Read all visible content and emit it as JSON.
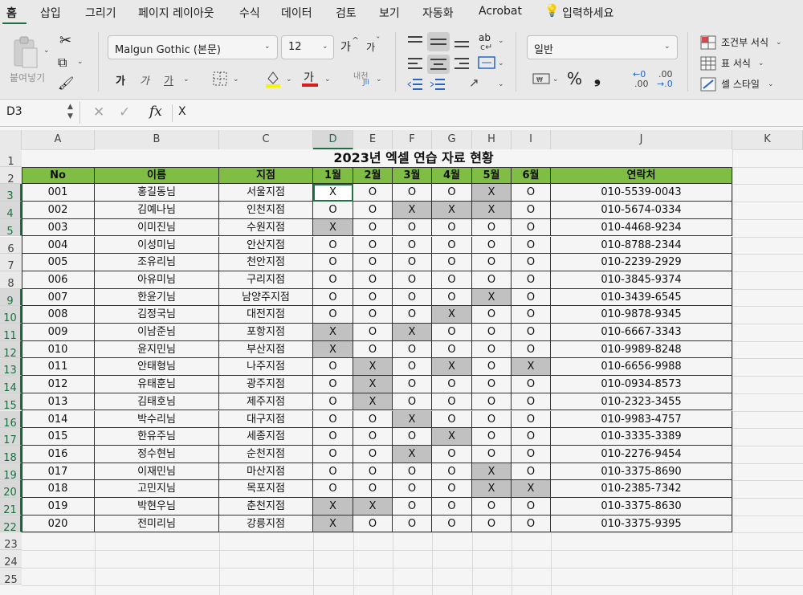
{
  "tabs": [
    "홈",
    "삽입",
    "그리기",
    "페이지 레이아웃",
    "수식",
    "데이터",
    "검토",
    "보기",
    "자동화",
    "Acrobat",
    "입력하세요"
  ],
  "ribbon": {
    "paste_label": "붙여넣기",
    "font_name": "Malgun Gothic (본문)",
    "font_size": "12",
    "grow_font": "가",
    "shrink_font": "가",
    "bold": "가",
    "italic": "가",
    "underline": "가",
    "font_color_glyph": "가",
    "phonetic": "내천",
    "number_format": "일반",
    "conditional_format": "조건부 서식",
    "format_table": "표 서식",
    "cell_styles": "셀 스타일",
    "percent": "%",
    "comma": "❟",
    "inc_decimal_a": "←0",
    "inc_decimal_b": ".00",
    "dec_decimal_a": ".00",
    "dec_decimal_b": "→.0",
    "wrap_text": "ab"
  },
  "formula_bar": {
    "name_box": "D3",
    "fx": "fx",
    "value": "X"
  },
  "sheet": {
    "columns": [
      "A",
      "B",
      "C",
      "D",
      "E",
      "F",
      "G",
      "H",
      "I",
      "J",
      "K"
    ],
    "selected_column": "D",
    "selected_rows": [
      3,
      4,
      5,
      9,
      10,
      11,
      12,
      13,
      14,
      15,
      16,
      17,
      18,
      19,
      20,
      21,
      22
    ],
    "row_numbers": [
      "1",
      "2",
      "3",
      "4",
      "5",
      "6",
      "7",
      "8",
      "9",
      "10",
      "11",
      "12",
      "13",
      "14",
      "15",
      "16",
      "17",
      "18",
      "19",
      "20",
      "21",
      "22",
      "23",
      "24",
      "25"
    ],
    "title": "2023년 엑셀 연습 자료 현황",
    "headers": [
      "No",
      "이름",
      "지점",
      "1월",
      "2월",
      "3월",
      "4월",
      "5월",
      "6월",
      "연락처"
    ],
    "rows": [
      [
        "001",
        "홍길동님",
        "서울지점",
        "X",
        "O",
        "O",
        "O",
        "X",
        "O",
        "010-5539-0043"
      ],
      [
        "002",
        "김예나님",
        "인천지점",
        "O",
        "O",
        "X",
        "X",
        "X",
        "O",
        "010-5674-0334"
      ],
      [
        "003",
        "이미진님",
        "수원지점",
        "X",
        "O",
        "O",
        "O",
        "O",
        "O",
        "010-4468-9234"
      ],
      [
        "004",
        "이성미님",
        "안산지점",
        "O",
        "O",
        "O",
        "O",
        "O",
        "O",
        "010-8788-2344"
      ],
      [
        "005",
        "조유리님",
        "천안지점",
        "O",
        "O",
        "O",
        "O",
        "O",
        "O",
        "010-2239-2929"
      ],
      [
        "006",
        "아유미님",
        "구리지점",
        "O",
        "O",
        "O",
        "O",
        "O",
        "O",
        "010-3845-9374"
      ],
      [
        "007",
        "한윤기님",
        "남양주지점",
        "O",
        "O",
        "O",
        "O",
        "X",
        "O",
        "010-3439-6545"
      ],
      [
        "008",
        "김정국님",
        "대전지점",
        "O",
        "O",
        "O",
        "X",
        "O",
        "O",
        "010-9878-9345"
      ],
      [
        "009",
        "이남준님",
        "포항지점",
        "X",
        "O",
        "X",
        "O",
        "O",
        "O",
        "010-6667-3343"
      ],
      [
        "010",
        "윤지민님",
        "부산지점",
        "X",
        "O",
        "O",
        "O",
        "O",
        "O",
        "010-9989-8248"
      ],
      [
        "011",
        "안태형님",
        "나주지점",
        "O",
        "X",
        "O",
        "X",
        "O",
        "X",
        "010-6656-9988"
      ],
      [
        "012",
        "유태훈님",
        "광주지점",
        "O",
        "X",
        "O",
        "O",
        "O",
        "O",
        "010-0934-8573"
      ],
      [
        "013",
        "김태호님",
        "제주지점",
        "O",
        "X",
        "O",
        "O",
        "O",
        "O",
        "010-2323-3455"
      ],
      [
        "014",
        "박수리님",
        "대구지점",
        "O",
        "O",
        "X",
        "O",
        "O",
        "O",
        "010-9983-4757"
      ],
      [
        "015",
        "한유주님",
        "세종지점",
        "O",
        "O",
        "O",
        "X",
        "O",
        "O",
        "010-3335-3389"
      ],
      [
        "016",
        "정수현님",
        "순천지점",
        "O",
        "O",
        "X",
        "O",
        "O",
        "O",
        "010-2276-9454"
      ],
      [
        "017",
        "이재민님",
        "마산지점",
        "O",
        "O",
        "O",
        "O",
        "X",
        "O",
        "010-3375-8690"
      ],
      [
        "018",
        "고민지님",
        "목포지점",
        "O",
        "O",
        "O",
        "O",
        "X",
        "X",
        "010-2385-7342"
      ],
      [
        "019",
        "박현우님",
        "춘천지점",
        "X",
        "X",
        "O",
        "O",
        "O",
        "O",
        "010-3375-8630"
      ],
      [
        "020",
        "전미리님",
        "강릉지점",
        "X",
        "O",
        "O",
        "O",
        "O",
        "O",
        "010-3375-9395"
      ]
    ]
  },
  "colors": {
    "accent": "#217346",
    "header_fill": "#86c548",
    "x_fill": "#c9c9c9"
  }
}
